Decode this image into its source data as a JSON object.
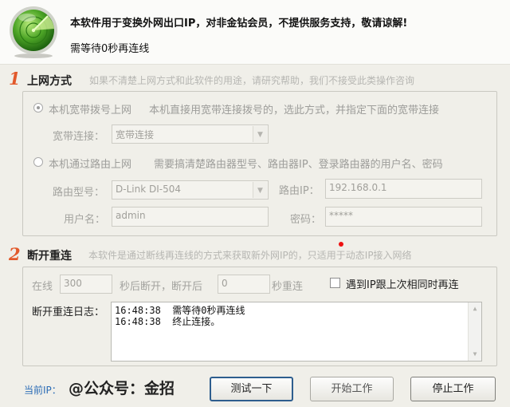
{
  "header": {
    "notice": "本软件用于变换外网出口IP，对非金钻会员，不提供服务支持，敬请谅解!",
    "wait_text": "需等待0秒再连线"
  },
  "section1": {
    "number": "1",
    "title": "上网方式",
    "desc": "如果不清楚上网方式和此软件的用途，请研究帮助，我们不接受此类操作咨询",
    "option_broadband": {
      "label": "本机宽带拨号上网",
      "desc": "本机直接用宽带连接拨号的，选此方式，并指定下面的宽带连接",
      "selected": true
    },
    "broadband_label": "宽带连接：",
    "broadband_value": "宽带连接",
    "option_router": {
      "label": "本机通过路由上网",
      "desc": "需要搞清楚路由器型号、路由器IP、登录路由器的用户名、密码",
      "selected": false
    },
    "router_model_label": "路由型号：",
    "router_model_value": "D-Link DI-504",
    "router_ip_label": "路由IP：",
    "router_ip_value": "192.168.0.1",
    "username_label": "用户名：",
    "username_value": "admin",
    "password_label": "密码：",
    "password_value": "*****"
  },
  "section2": {
    "number": "2",
    "title": "断开重连",
    "desc_part1": "本软件是通过断线再连线的方式来获取新外网IP的",
    "desc_part2": "，只适用于动态IP接入网络",
    "online_label": "在线",
    "online_value": "300",
    "after_label": "秒后断开，断开后",
    "reconnect_value": "0",
    "reconnect_label": "秒重连",
    "same_ip_label": "遇到IP跟上次相同时再连",
    "same_ip_checked": false,
    "log_label": "断开重连日志：",
    "log_lines": [
      "16:48:38  需等待0秒再连线",
      "16:48:38  终止连接。"
    ]
  },
  "footer": {
    "current_ip_label": "当前IP：",
    "current_ip_value": "@公众号：金招",
    "test_button": "测试一下",
    "start_button": "开始工作",
    "stop_button": "停止工作"
  },
  "colors": {
    "section_number": "#e2592b",
    "ip_label": "#2b6cb6",
    "primary_border": "#2e5e8e"
  },
  "icons": {
    "logo": "radar-icon"
  }
}
